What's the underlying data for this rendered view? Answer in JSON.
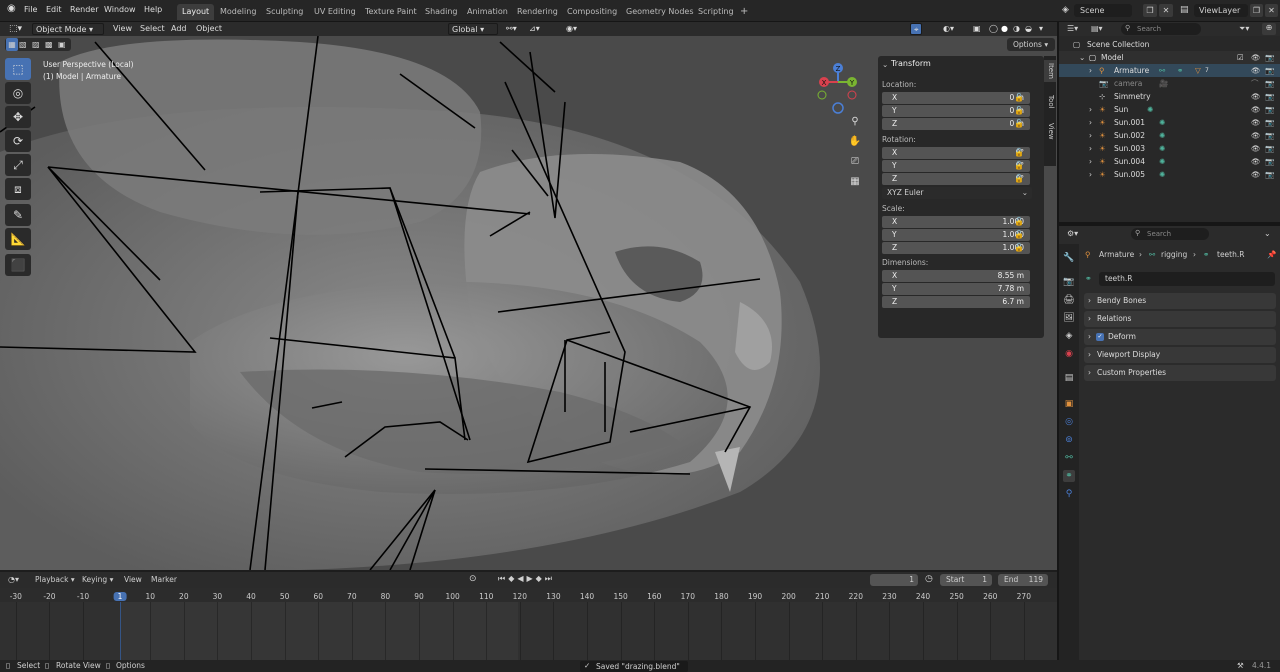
{
  "menu": {
    "items": [
      "File",
      "Edit",
      "Render",
      "Window",
      "Help"
    ],
    "workspaces": [
      "Layout",
      "Modeling",
      "Sculpting",
      "UV Editing",
      "Texture Paint",
      "Shading",
      "Animation",
      "Rendering",
      "Compositing",
      "Geometry Nodes",
      "Scripting"
    ],
    "active_workspace": "Layout",
    "add_tab": "+",
    "scene_label": "Scene",
    "viewlayer_label": "ViewLayer"
  },
  "viewport": {
    "mode": "Object Mode",
    "menu": [
      "View",
      "Select",
      "Add",
      "Object"
    ],
    "orientation": "Global",
    "options": "Options",
    "info_line1": "User Perspective (Local)",
    "info_line2": "(1) Model | Armature",
    "gizmo": {
      "x": "X",
      "y": "Y",
      "z": "Z"
    }
  },
  "npanel": {
    "title": "Transform",
    "location_label": "Location:",
    "location": [
      {
        "axis": "X",
        "value": "0 m"
      },
      {
        "axis": "Y",
        "value": "0 m"
      },
      {
        "axis": "Z",
        "value": "0 m"
      }
    ],
    "rotation_label": "Rotation:",
    "rotation": [
      {
        "axis": "X",
        "value": "0°"
      },
      {
        "axis": "Y",
        "value": "0°"
      },
      {
        "axis": "Z",
        "value": "0°"
      }
    ],
    "rotation_mode": "XYZ Euler",
    "scale_label": "Scale:",
    "scale": [
      {
        "axis": "X",
        "value": "1.000"
      },
      {
        "axis": "Y",
        "value": "1.000"
      },
      {
        "axis": "Z",
        "value": "1.000"
      }
    ],
    "dimensions_label": "Dimensions:",
    "dimensions": [
      {
        "axis": "X",
        "value": "8.55 m"
      },
      {
        "axis": "Y",
        "value": "7.78 m"
      },
      {
        "axis": "Z",
        "value": "6.7 m"
      }
    ],
    "tabs": [
      "Item",
      "Tool",
      "View"
    ]
  },
  "outliner": {
    "search_placeholder": "Search",
    "items": [
      "Scene Collection",
      "Model",
      "Armature",
      "camera",
      "Simmetry",
      "Sun",
      "Sun.001",
      "Sun.002",
      "Sun.003",
      "Sun.004",
      "Sun.005"
    ],
    "modifier_count": "7"
  },
  "properties": {
    "search_placeholder": "Search",
    "breadcrumb": [
      "Armature",
      "rigging",
      "teeth.R"
    ],
    "bone_name": "teeth.R",
    "panels": [
      "Bendy Bones",
      "Relations",
      "Deform",
      "Viewport Display",
      "Custom Properties"
    ]
  },
  "timeline": {
    "menu": [
      "Playback",
      "Keying",
      "View",
      "Marker"
    ],
    "current_frame": "1",
    "start_label": "Start",
    "start": "1",
    "end_label": "End",
    "end": "119",
    "ticks": [
      "-30",
      "-20",
      "-10",
      "1",
      "10",
      "20",
      "30",
      "40",
      "50",
      "60",
      "70",
      "80",
      "90",
      "100",
      "110",
      "120",
      "130",
      "140",
      "150",
      "160",
      "170",
      "180",
      "190",
      "200",
      "210",
      "220",
      "230",
      "240",
      "250",
      "260",
      "270"
    ]
  },
  "status": {
    "select": "Select",
    "rotate": "Rotate View",
    "options": "Options",
    "message": "Saved \"drazing.blend\"",
    "version": "4.4.1"
  },
  "colors": {
    "accent": "#4772b3",
    "active_bone": "#4fb29b",
    "light": "#e0913e"
  }
}
